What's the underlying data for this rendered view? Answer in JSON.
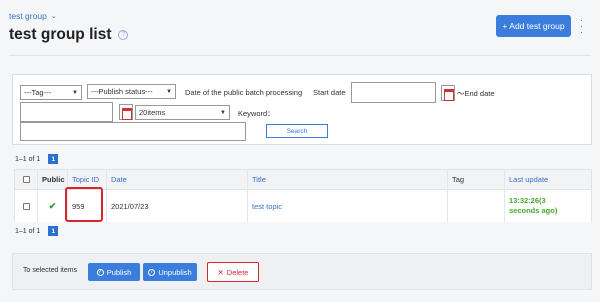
{
  "header": {
    "breadcrumb": "test group",
    "title": "test group list",
    "add_button": "+ Add test group"
  },
  "filter": {
    "tag_select": "---Tag---",
    "publish_status_select": "---Publish status---",
    "date_label": "Date of the public batch processing",
    "start_date_label": "Start date",
    "end_date_label": "〜End date",
    "per_page_select": "20items",
    "keyword_label": "Keyword：",
    "search_button": "Search"
  },
  "pagination": {
    "range": "1–1 of 1",
    "page": "1"
  },
  "table": {
    "columns": [
      "Public",
      "Topic ID",
      "Date",
      "Title",
      "Tag",
      "Last update"
    ],
    "rows": [
      {
        "public_mark": "✔",
        "topic_id": "959",
        "date": "2021/07/23",
        "title": "test topic",
        "tag": "",
        "last_update_time": "13:32:26(3",
        "last_update_ago": "seconds ago)"
      }
    ]
  },
  "bulk_actions": {
    "label": "To selected items",
    "publish": "Publish",
    "unpublish": "Unpublish",
    "delete": "Delete"
  },
  "colors": {
    "primary": "#3b7ddd",
    "danger": "#d9262c",
    "success": "#4aa82e"
  }
}
